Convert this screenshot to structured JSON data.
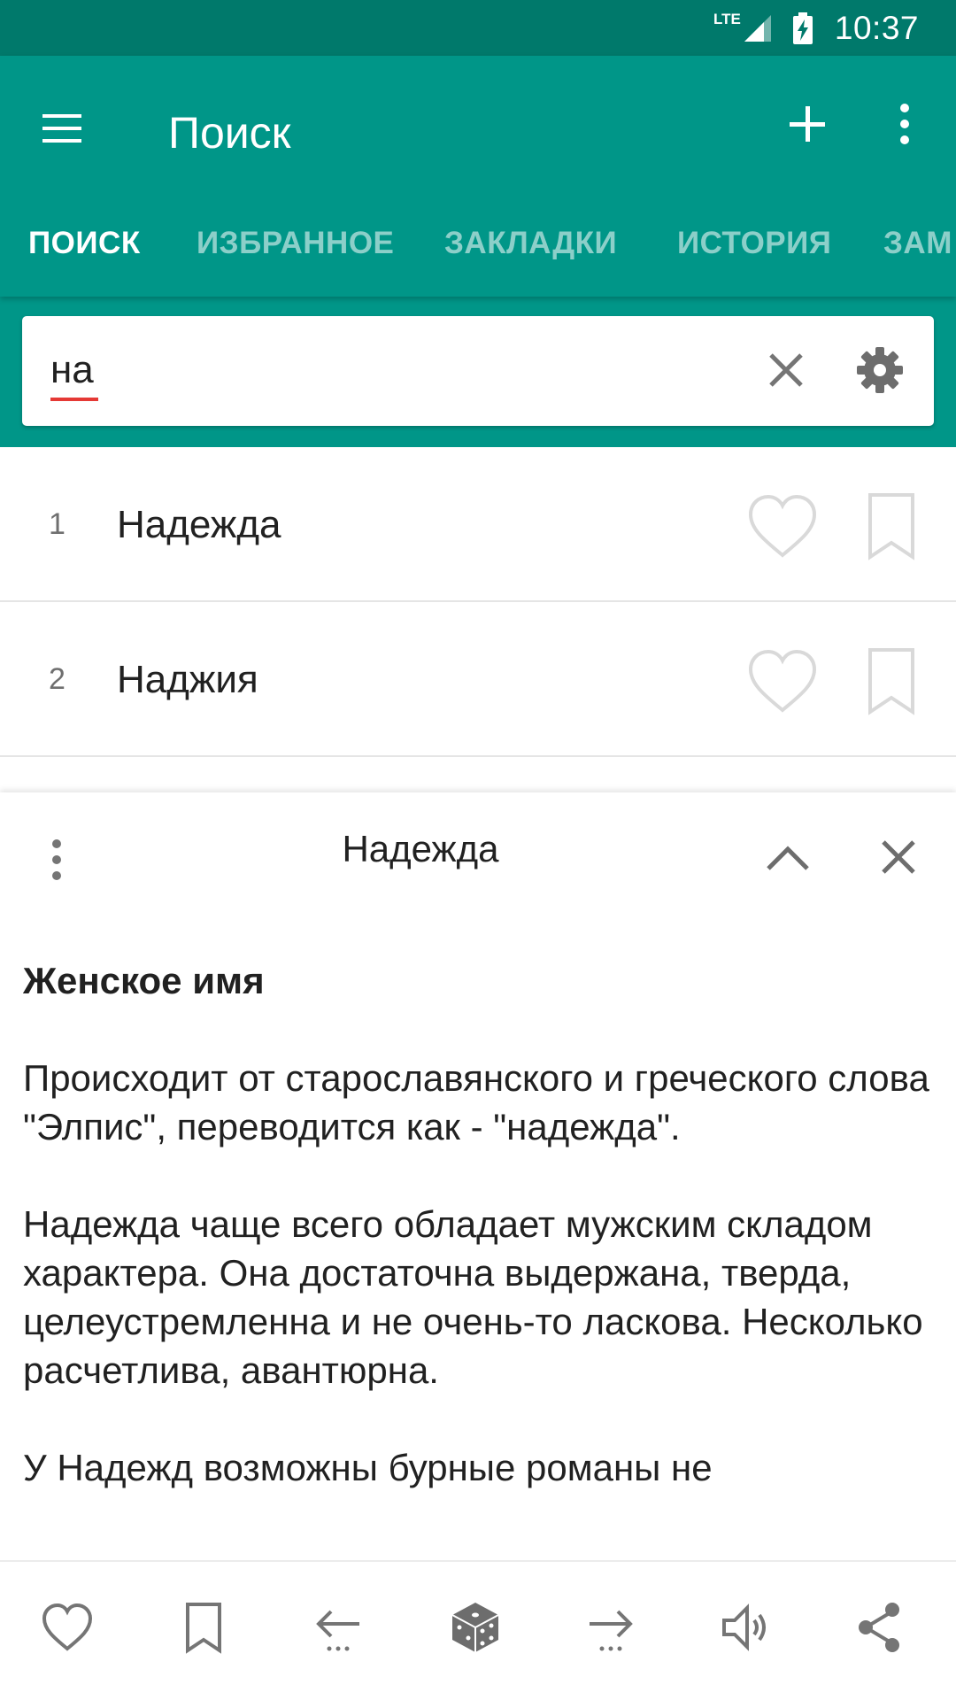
{
  "status": {
    "network": "LTE",
    "time": "10:37"
  },
  "appbar": {
    "title": "Поиск"
  },
  "tabs": [
    "ПОИСК",
    "ИЗБРАННОЕ",
    "ЗАКЛАДКИ",
    "ИСТОРИЯ",
    "ЗАМ"
  ],
  "search": {
    "query": "на"
  },
  "results": [
    {
      "num": "1",
      "word": "Надежда"
    },
    {
      "num": "2",
      "word": "Наджия"
    }
  ],
  "detail": {
    "title": "Надежда",
    "heading": "Женское имя",
    "paragraphs": [
      "Происходит от старославянского и греческого слова \"Элпис\", переводится как - \"надежда\".",
      "Надежда чаще всего обладает мужским складом характера. Она достаточна выдержана, тверда, целеустремленна и не очень-то ласкова. Несколько расчетлива, авантюрна.",
      "У Надежд возможны бурные романы не"
    ]
  },
  "colors": {
    "primary": "#009688",
    "primary_dark": "#00796b",
    "icon_grey": "#757575",
    "spell_underline": "#e53935"
  }
}
